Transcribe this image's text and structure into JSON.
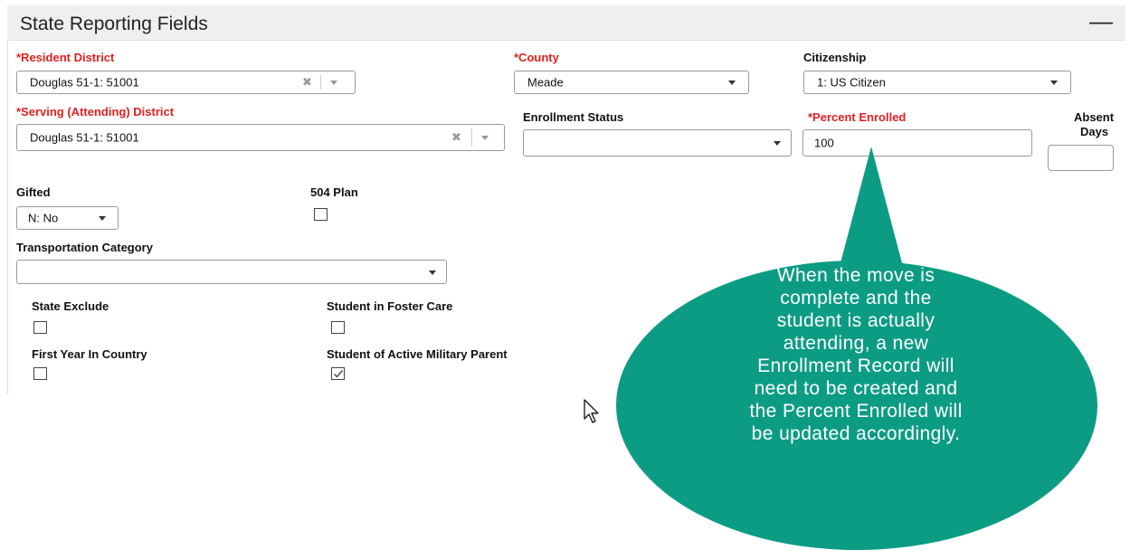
{
  "panel": {
    "title": "State Reporting Fields",
    "collapse_symbol": "—"
  },
  "fields": {
    "resident_district": {
      "label": "*Resident District",
      "value": "Douglas 51-1: 51001"
    },
    "county": {
      "label": "*County",
      "value": "Meade"
    },
    "citizenship": {
      "label": "Citizenship",
      "value": "1: US Citizen"
    },
    "serving_district": {
      "label": "*Serving (Attending) District",
      "value": "Douglas 51-1: 51001"
    },
    "enrollment_status": {
      "label": "Enrollment Status",
      "value": ""
    },
    "percent_enrolled": {
      "label": "*Percent Enrolled",
      "value": "100"
    },
    "absent_days": {
      "label_line1": "Absent",
      "label_line2": "Days",
      "value": ""
    },
    "gifted": {
      "label": "Gifted",
      "value": "N: No"
    },
    "plan_504": {
      "label": "504 Plan",
      "checked": false
    },
    "transportation_category": {
      "label": "Transportation Category",
      "value": ""
    },
    "state_exclude": {
      "label": "State Exclude",
      "checked": false
    },
    "foster_care": {
      "label": "Student in Foster Care",
      "checked": false
    },
    "first_year_in_country": {
      "label": "First Year In Country",
      "checked": false
    },
    "active_military_parent": {
      "label": "Student of Active Military Parent",
      "checked": true
    }
  },
  "callout": {
    "lines": [
      "When the move is",
      "complete and the",
      "student is actually",
      "attending, a new",
      "Enrollment Record will",
      "need to be created and",
      "the Percent Enrolled will",
      "be updated accordingly."
    ],
    "color": "#0c9c84"
  },
  "colors": {
    "required_label": "#e02020",
    "header_bg": "#efefef"
  },
  "icons": {
    "cursor": "mouse-pointer-icon",
    "clear": "clear-icon",
    "dropdown": "chevron-down-icon",
    "check": "checkmark-icon"
  }
}
